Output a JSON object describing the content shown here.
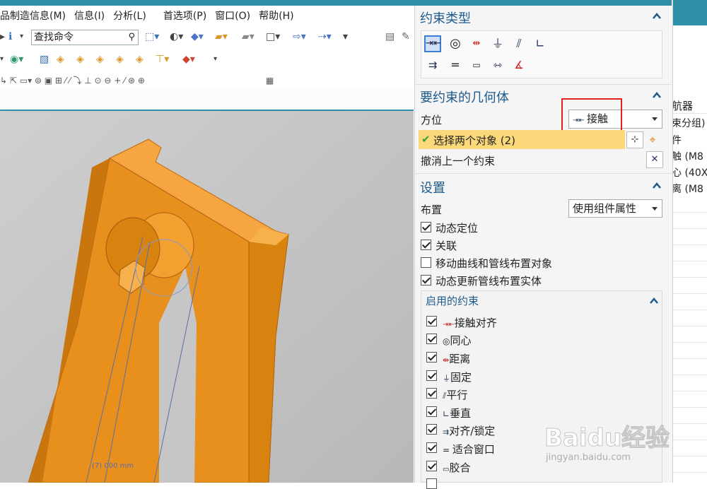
{
  "menubar": {
    "items": [
      "品制造信息(M)",
      "信息(I)",
      "分析(L)",
      "首选项(P)",
      "窗口(O)",
      "帮助(H)"
    ]
  },
  "toolbar": {
    "search_value": "查找命令"
  },
  "dialog": {
    "constraint_type": {
      "title": "约束类型"
    },
    "geometry": {
      "title": "要约束的几何体",
      "orientation_label": "方位",
      "orientation_value": "接触",
      "select_objects": "选择两个对象 (2)",
      "undo_last": "撤消上一个约束"
    },
    "settings": {
      "title": "设置",
      "layout_label": "布置",
      "layout_value": "使用组件属性",
      "options": [
        {
          "label": "动态定位",
          "checked": true
        },
        {
          "label": "关联",
          "checked": true
        },
        {
          "label": "移动曲线和管线布置对象",
          "checked": false
        },
        {
          "label": "动态更新管线布置实体",
          "checked": true
        }
      ]
    },
    "enabled_constraints": {
      "title": "启用的约束",
      "items": [
        {
          "label": "接触对齐",
          "checked": true
        },
        {
          "label": "同心",
          "checked": true
        },
        {
          "label": "距离",
          "checked": true
        },
        {
          "label": "固定",
          "checked": true
        },
        {
          "label": "平行",
          "checked": true
        },
        {
          "label": "垂直",
          "checked": true
        },
        {
          "label": "对齐/锁定",
          "checked": true
        },
        {
          "label": "适合窗口",
          "checked": true
        },
        {
          "label": "胶合",
          "checked": true
        }
      ]
    }
  },
  "right_panel": {
    "header": "航器",
    "rows": [
      "束分组)",
      "件",
      "触 (M8",
      "心 (40X",
      "离 (M8"
    ]
  },
  "viewport": {
    "dimension_text": "(7) 000 mm"
  },
  "watermark": {
    "brand": "Baidu经验",
    "url": "jingyan.baidu.com"
  },
  "colors": {
    "accent": "#2f8fa6",
    "section_title": "#1e5a8c",
    "highlight_row": "#fbd97a",
    "part_orange": "#f0961e",
    "red_box": "#e02020"
  }
}
